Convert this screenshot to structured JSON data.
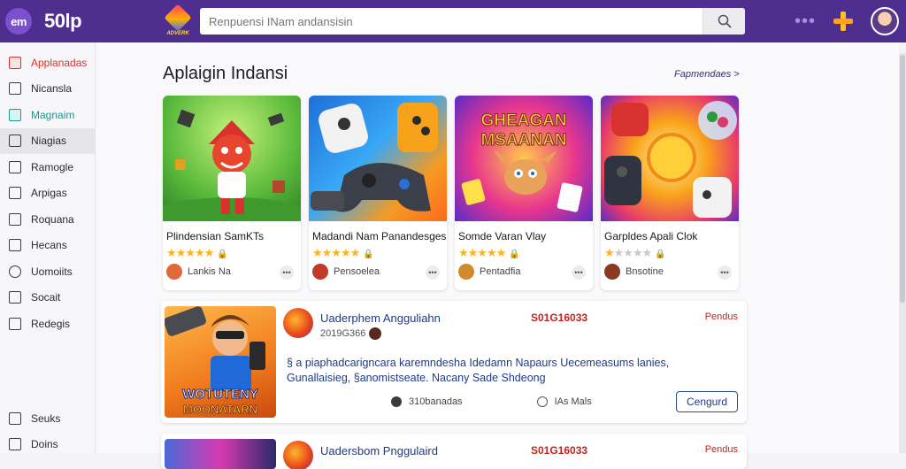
{
  "header": {
    "brand_badge": "em",
    "brand_name": "50lp",
    "logo_label": "ADVERK",
    "search": {
      "placeholder": "Renpuensi INam andansisin",
      "value": ""
    },
    "more_dots": "•••"
  },
  "sidebar": {
    "items": [
      {
        "label": "Applanadas",
        "accent": "red"
      },
      {
        "label": "Nicansla",
        "accent": ""
      },
      {
        "label": "Magnaim",
        "accent": "teal"
      },
      {
        "label": "Niagias",
        "accent": "",
        "active": true
      },
      {
        "label": "Ramogle",
        "accent": ""
      },
      {
        "label": "Arpigas",
        "accent": ""
      },
      {
        "label": "Roquana",
        "accent": ""
      },
      {
        "label": "Hecans",
        "accent": ""
      },
      {
        "label": "Uomoiits",
        "accent": ""
      },
      {
        "label": "Socait",
        "accent": ""
      },
      {
        "label": "Redegis",
        "accent": ""
      }
    ],
    "bottom_items": [
      {
        "label": "Seuks"
      },
      {
        "label": "Doins"
      }
    ]
  },
  "main": {
    "section_title": "Aplaigin Indansi",
    "section_link": "Fapmendaes >",
    "cards": [
      {
        "name": "Plindensian SamKTs",
        "rating": 5,
        "developer": "Lankis Na",
        "art": "goblin-art",
        "dev_color": "#e0683a"
      },
      {
        "name": "Madandi Nam Panandesges",
        "rating": 5,
        "developer": "Pensoelea",
        "art": "controllers-art",
        "dev_color": "#c43a2a"
      },
      {
        "name": "Somde Varan Vlay",
        "rating": 5,
        "developer": "Pentadfia",
        "art": "creature-art",
        "dev_color": "#d08a2a",
        "art_title": "GHEAGAN MSAANAN"
      },
      {
        "name": "Garpldes Apali Clok",
        "rating": 1,
        "developer": "Bnsotine",
        "art": "orbs-art",
        "dev_color": "#8a3a20"
      }
    ],
    "features": [
      {
        "title": "Uaderphem Angguliahn",
        "subtitle": "2019G366",
        "price": "S01G16033",
        "tag": "Pendus",
        "description": "§ a piaphadcarigncara karemndesha Idedamn Napaurs Uecemeasums lanies, Gunallaisieg, §anomistseate. Nacany Sade Shdeong",
        "art_title": "WOTUTENY MOONATARN",
        "meta_left": "310banadas",
        "meta_right": "IAs Mals",
        "button": "Cengurd"
      },
      {
        "title": "Uadersbom Pnggulaird",
        "price": "S01G16033",
        "tag": "Pendus"
      }
    ]
  }
}
